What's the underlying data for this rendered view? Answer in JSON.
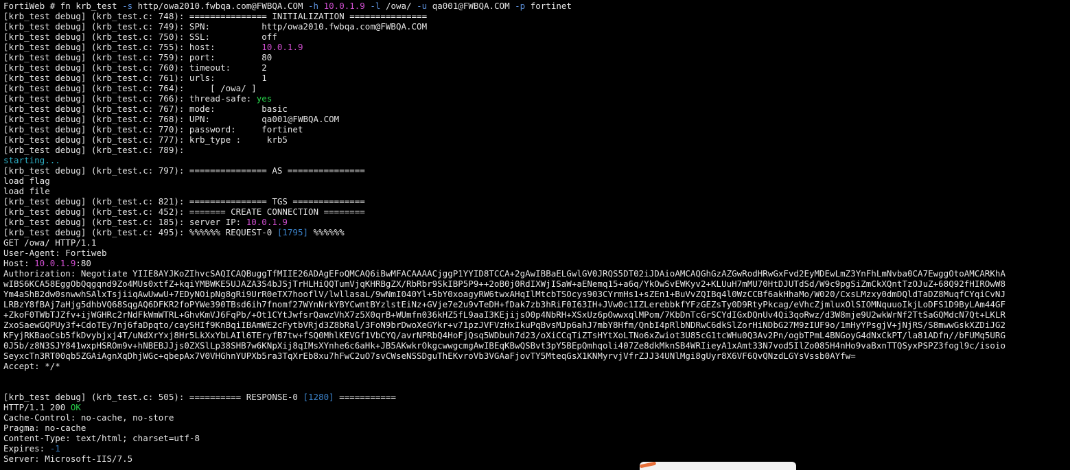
{
  "colors": {
    "background": "#000000",
    "text": "#e6e6e6",
    "argument": "#5b8fd9",
    "ip": "#d14fd1",
    "success": "#27d34a",
    "status": "#2eb1c7",
    "number": "#3b82c9"
  },
  "terminal": {
    "lines": [
      [
        {
          "t": "FortiWeb # fn krb_test "
        },
        {
          "t": "-s",
          "c": "arg"
        },
        {
          "t": " http/owa2010.fwbqa.com@FWBQA.COM "
        },
        {
          "t": "-h",
          "c": "arg"
        },
        {
          "t": " "
        },
        {
          "t": "10.0.1.9",
          "c": "ip"
        },
        {
          "t": " "
        },
        {
          "t": "-l",
          "c": "arg"
        },
        {
          "t": " /owa/ "
        },
        {
          "t": "-u",
          "c": "arg"
        },
        {
          "t": " qa001@FWBQA.COM "
        },
        {
          "t": "-p",
          "c": "arg"
        },
        {
          "t": " fortinet"
        }
      ],
      [
        {
          "t": "[krb_test debug] (krb_test.c: 748): =============== INITIALIZATION ==============="
        }
      ],
      [
        {
          "t": "[krb_test debug] (krb_test.c: 749): SPN:          http/owa2010.fwbqa.com@FWBQA.COM"
        }
      ],
      [
        {
          "t": "[krb_test debug] (krb_test.c: 750): SSL:          off"
        }
      ],
      [
        {
          "t": "[krb_test debug] (krb_test.c: 755): host:         "
        },
        {
          "t": "10.0.1.9",
          "c": "ip"
        }
      ],
      [
        {
          "t": "[krb_test debug] (krb_test.c: 759): port:         80"
        }
      ],
      [
        {
          "t": "[krb_test debug] (krb_test.c: 760): timeout:      2"
        }
      ],
      [
        {
          "t": "[krb_test debug] (krb_test.c: 761): urls:         1"
        }
      ],
      [
        {
          "t": "[krb_test debug] (krb_test.c: 764):     [ /owa/ ]"
        }
      ],
      [
        {
          "t": "[krb_test debug] (krb_test.c: 766): thread-safe: "
        },
        {
          "t": "yes",
          "c": "green"
        }
      ],
      [
        {
          "t": "[krb_test debug] (krb_test.c: 767): mode:         basic"
        }
      ],
      [
        {
          "t": "[krb_test debug] (krb_test.c: 768): UPN:          qa001@FWBQA.COM"
        }
      ],
      [
        {
          "t": "[krb_test debug] (krb_test.c: 770): password:     fortinet"
        }
      ],
      [
        {
          "t": "[krb_test debug] (krb_test.c: 777): krb_type :     krb5"
        }
      ],
      [
        {
          "t": "[krb_test debug] (krb_test.c: 789):"
        }
      ],
      [
        {
          "t": "starting...",
          "c": "cyan"
        }
      ],
      [
        {
          "t": "[krb_test debug] (krb_test.c: 797): =============== AS ==============="
        }
      ],
      [
        {
          "t": "load flag"
        }
      ],
      [
        {
          "t": "load file"
        }
      ],
      [
        {
          "t": "[krb_test debug] (krb_test.c: 821): =============== TGS =============="
        }
      ],
      [
        {
          "t": "[krb_test debug] (krb_test.c: 452): ======= CREATE CONNECTION ========"
        }
      ],
      [
        {
          "t": "[krb_test debug] (krb_test.c: 185): server IP: "
        },
        {
          "t": "10.0.1.9",
          "c": "ip"
        }
      ],
      [
        {
          "t": "[krb_test debug] (krb_test.c: 495): %%%%%% REQUEST-0 "
        },
        {
          "t": "[1795]",
          "c": "num"
        },
        {
          "t": " %%%%%%"
        }
      ],
      [
        {
          "t": "GET /owa/ HTTP/1.1"
        }
      ],
      [
        {
          "t": "User-Agent: Fortiweb"
        }
      ],
      [
        {
          "t": "Host: "
        },
        {
          "t": "10.0.1.9",
          "c": "ip"
        },
        {
          "t": ":80"
        }
      ],
      [
        {
          "t": "Authorization: Negotiate YIIE8AYJKoZIhvcSAQICAQBuggTfMIIE26ADAgEFoQMCAQ6iBwMFACAAAACjggP1YYID8TCCA+2gAwIBBaELGwlGV0JRQS5DT02iJDAioAMCAQGhGzAZGwRodHRwGxFvd2EyMDEwLmZ3YnFhLmNvba0CA7EwggOtoAMCARKhA"
        }
      ],
      [
        {
          "t": "wIBS6KCA58EggObQqgqnd9Zo4MUs0xtfZ+kqiYMBWKE5UJAZA3S4bJSjTrHLHiQQTumVjqKHRBgZX/RbRbr9SkIBP5P9++2oB0j0RdIXWjISaW+aENemq15+a6q/YkOwSvEWKyv2+KLUuH7mMU70HtDJUTdSd/W9c9pgSiZmCkXQntTzOJuZ+68Q92fHIROwW8"
        }
      ],
      [
        {
          "t": "Ym4aShB2dw0snwwhSAlxTsjiiqAwUwwU+7EDyNOipNg8gRi9UrR0eTX7hooflV/lwllasaL/9wNmI040Yl+5bY0xoagyRW6twxAHqIlMtcbTSOcys903CYrmHs1+sZEn1+BuVvZQIBq4l0WzCCBf6akHhaMo/W020/CxsLMzxy0dmDQldTaDZ8MuqfCYqiCvNJ"
        }
      ],
      [
        {
          "t": "LRBzY8fBAj7aHjg5dhbVQ68SqgAQ6DFKR2foPYWe390TBsd6ih7fnomf27WYnNrkYBYCwntBYzlstEiNz+GVje7e2u9vTeDH+fDak7zb3hRiF0I63IH+JVw0c1IZLerebbkfYFzGEZsTy0D9RtyPkcag/eVhcZjmluxOlSIOMNquuoIkjLoDFS1D9ByLAm44GF"
        }
      ],
      [
        {
          "t": "+ZkoF0TWbTJZfv+ijWGHRc2rNdFkWmWTRL+GhvKmVJ6FqPb/+Ot1CYtJwfsrQawzVhX7z5X0qrB+WUmfn036kHZ5fL9aaI3KEjijsO0p4NbRH+XSxUz6pOwwxqlMPom/7KbDnTcGrSCYdIGxDQnUv4Qi3qoRwz/d3W8mje9U2wkWrNf2TtSaGQMdcN7Qt+LKLR"
        }
      ],
      [
        {
          "t": "ZxoSaewGQPUy3f+CdoTEy7nj6faDpqto/caySHIf9KnBqiIBAmWE2cFytbVRjd3Z8bRal/3FoN9brDwoXeGYkr+v71pzJVFVzHxIkuPqBvsMJp6ahJ7mbY8Hfm/QnbI4pRlbNDRwC6dkSlZorHiNDbG27M9zIUF9o/1mHyYPsgjV+jNjRS/S8mwwGskXZDiJG2"
        }
      ],
      [
        {
          "t": "KFyjRKBaoCsb5fkDvybjxj4T/uNdXrYxj8Hr5LkXxYbLAIl6TEryfB7tw+fSQ0MhlKEVGf1VbCYQ/avrNPRbQ4HoFjQsq5WDbuh7d23/oXiCCqTiZTsHYtXoLTNo6xZwiot3U85cG1tcWHu0Q3Av2Pn/ogbTPmL4BNGoyG4dNxCkPT/la81ADfn//bFUMq5URG"
        }
      ],
      [
        {
          "t": "0J5b/z8N3SJY841wxpHSROm9v+hNBEBJJjs0ZXSlLp38SHB7w6KNpXij8qIMsXYnhe6c6aHk+JB5AKwkrOkgcwwgcmgAwIBEqKBwQSBvt3pY5BEpQmhqoli407Ze8dkMknSB4WRIieyA1xAmt33N7vod5IlZo085H4nHo9vaBxnTTQSyxPSPZ3fogl9c/isoio"
        }
      ],
      [
        {
          "t": "SeyxcTn3RT00qb5ZGAiAgnXqDhjWGc+qbepAx7V0VHGhnYUPXb5ra3TqXrEb8xu7hFwC2uO7svCWseNSSDguThEKvroVb3VGAaFjovTY5MteqGsX1KNMyrvjVfrZJJ34UNlMgi8gUyr8X6VF6QvQNzdLGYsVssb0AYfw="
        }
      ],
      [
        {
          "t": "Accept: */*"
        }
      ],
      [
        {
          "t": ""
        }
      ],
      [
        {
          "t": ""
        }
      ],
      [
        {
          "t": "[krb_test debug] (krb_test.c: 505): ========== RESPONSE-0 "
        },
        {
          "t": "[1280]",
          "c": "num"
        },
        {
          "t": " ==========="
        }
      ],
      [
        {
          "t": "HTTP/1.1 200 "
        },
        {
          "t": "OK",
          "c": "green"
        }
      ],
      [
        {
          "t": "Cache-Control: no-cache, no-store"
        }
      ],
      [
        {
          "t": "Pragma: no-cache"
        }
      ],
      [
        {
          "t": "Content-Type: text/html; charset=utf-8"
        }
      ],
      [
        {
          "t": "Expires: "
        },
        {
          "t": "-1",
          "c": "num"
        }
      ],
      [
        {
          "t": "Server: Microsoft-IIS/7.5"
        }
      ]
    ]
  }
}
